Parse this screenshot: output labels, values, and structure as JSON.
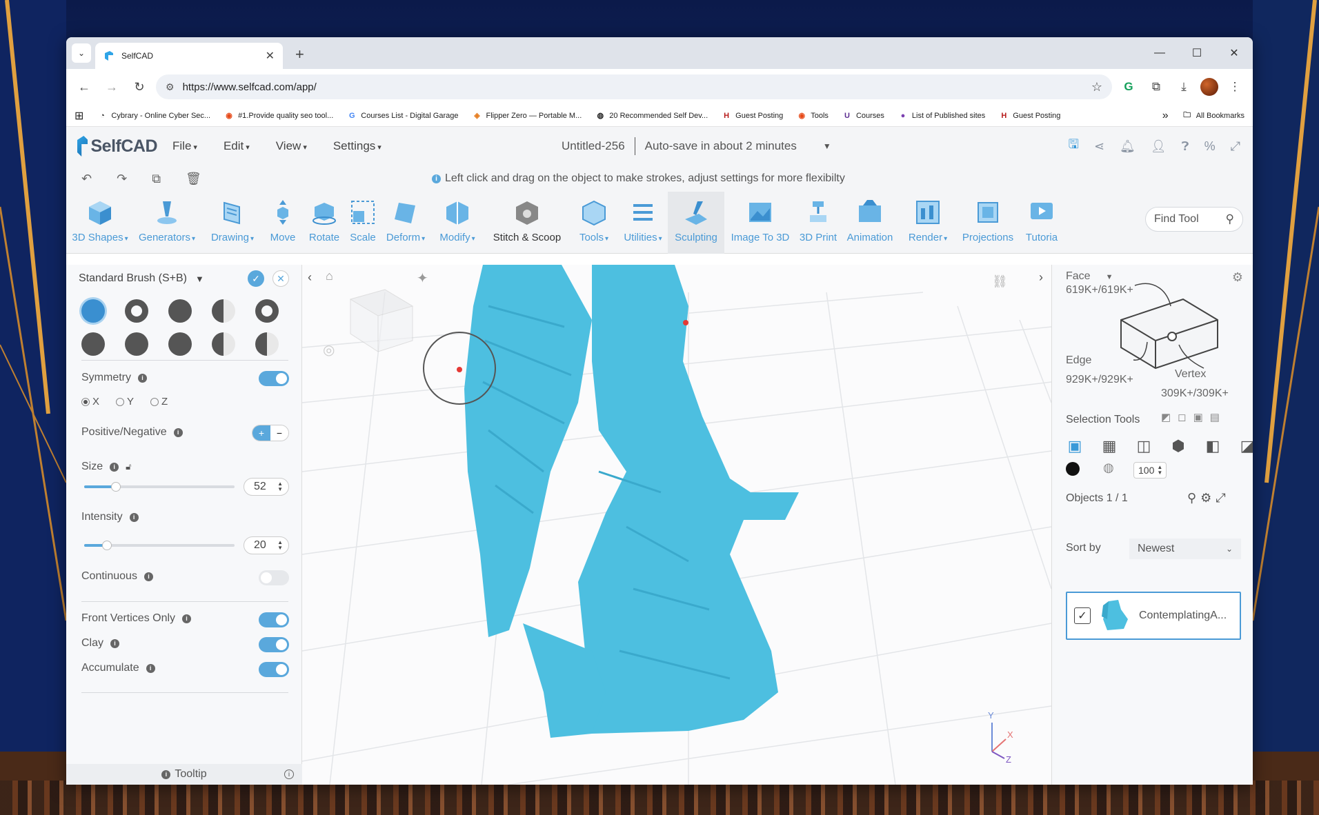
{
  "browser": {
    "tab_title": "SelfCAD",
    "url": "https://www.selfcad.com/app/",
    "bookmarks": [
      {
        "label": "Cybrary - Online Cyber Sec...",
        "icon": "cybrary-icon"
      },
      {
        "label": "#1.Provide quality seo tool...",
        "icon": "seo-icon"
      },
      {
        "label": "Courses List - Digital Garage",
        "icon": "google-icon"
      },
      {
        "label": "Flipper Zero — Portable M...",
        "icon": "flipper-icon"
      },
      {
        "label": "20 Recommended Self Dev...",
        "icon": "globe-icon"
      },
      {
        "label": "Guest Posting",
        "icon": "hl-icon"
      },
      {
        "label": "Tools",
        "icon": "tools-icon"
      },
      {
        "label": "Courses",
        "icon": "udemy-icon"
      },
      {
        "label": "List of Published sites",
        "icon": "list-icon"
      },
      {
        "label": "Guest Posting",
        "icon": "hl-icon"
      }
    ],
    "all_bookmarks": "All Bookmarks"
  },
  "app": {
    "logo": "SelfCAD",
    "menus": [
      "File",
      "Edit",
      "View",
      "Settings"
    ],
    "doc_title": "Untitled-256",
    "autosave": "Auto-save in about 2 minutes",
    "hint": "Left click and drag on the object to make strokes, adjust settings for more flexibilty"
  },
  "toolbar": [
    {
      "label": "3D Shapes",
      "dropdown": true
    },
    {
      "label": "Generators",
      "dropdown": true
    },
    {
      "label": "Drawing",
      "dropdown": true
    },
    {
      "label": "Move",
      "dropdown": false
    },
    {
      "label": "Rotate",
      "dropdown": false
    },
    {
      "label": "Scale",
      "dropdown": false
    },
    {
      "label": "Deform",
      "dropdown": true
    },
    {
      "label": "Modify",
      "dropdown": true
    },
    {
      "label": "Stitch & Scoop",
      "dropdown": false
    },
    {
      "label": "Tools",
      "dropdown": true
    },
    {
      "label": "Utilities",
      "dropdown": true
    },
    {
      "label": "Sculpting",
      "dropdown": false
    },
    {
      "label": "Image To 3D",
      "dropdown": false
    },
    {
      "label": "3D Print",
      "dropdown": false
    },
    {
      "label": "Animation",
      "dropdown": false
    },
    {
      "label": "Render",
      "dropdown": true
    },
    {
      "label": "Projections",
      "dropdown": false
    },
    {
      "label": "Tutoria",
      "dropdown": false
    }
  ],
  "find_tool": "Find Tool",
  "sculpt_panel": {
    "brush_name": "Standard Brush (S+B)",
    "symmetry_label": "Symmetry",
    "symmetry_on": true,
    "axes": [
      "X",
      "Y",
      "Z"
    ],
    "selected_axis": "X",
    "posneg_label": "Positive/Negative",
    "size_label": "Size",
    "size_value": "52",
    "size_fraction": 0.21,
    "intensity_label": "Intensity",
    "intensity_value": "20",
    "intensity_fraction": 0.15,
    "continuous_label": "Continuous",
    "continuous_on": false,
    "front_vertices_label": "Front Vertices Only",
    "front_vertices_on": true,
    "clay_label": "Clay",
    "clay_on": true,
    "accumulate_label": "Accumulate",
    "accumulate_on": true,
    "tooltip_label": "Tooltip"
  },
  "right_panel": {
    "face_label": "Face",
    "face_count": "619K+/619K+",
    "edge_label": "Edge",
    "edge_count": "929K+/929K+",
    "vertex_label": "Vertex",
    "vertex_count": "309K+/309K+",
    "selection_tools": "Selection Tools",
    "opacity_value": "100",
    "objects_label": "Objects 1 / 1",
    "sort_label": "Sort by",
    "sort_value": "Newest",
    "object_name": "ContemplatingA..."
  },
  "viewport": {
    "axis_x": "X",
    "axis_y": "Y",
    "axis_z": "Z"
  },
  "colors": {
    "accent": "#4a9ad6",
    "model": "#4dbfe0",
    "toggle_on": "#5aa8dc"
  }
}
